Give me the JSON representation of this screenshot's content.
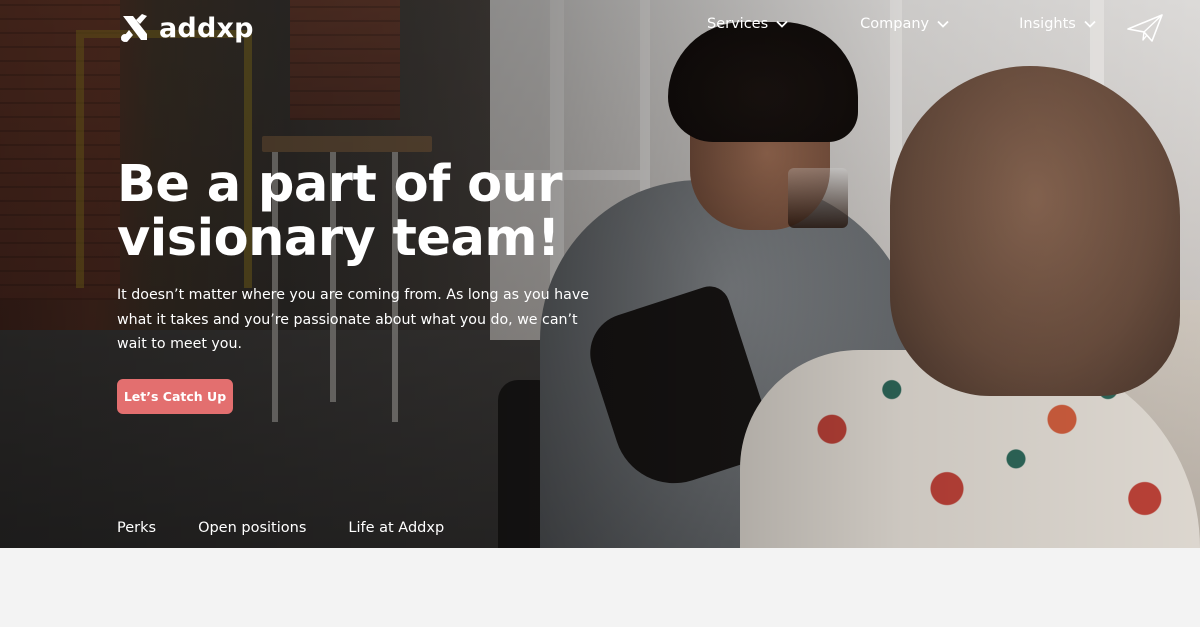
{
  "brand": {
    "name": "addxp"
  },
  "nav": {
    "items": [
      {
        "label": "Services"
      },
      {
        "label": "Company"
      },
      {
        "label": "Insights"
      }
    ],
    "contact_icon": "paper-plane-icon"
  },
  "hero": {
    "headline_line1": "Be a part of our",
    "headline_line2": "visionary team!",
    "description": "It doesn’t matter where you are coming from. As long as you have what it takes and you’re passionate about what you do, we can’t wait to meet you.",
    "cta_label": "Let’s Catch Up"
  },
  "subnav": {
    "items": [
      {
        "label": "Perks"
      },
      {
        "label": "Open positions"
      },
      {
        "label": "Life at Addxp"
      }
    ]
  },
  "colors": {
    "cta": "#e36f6f",
    "text": "#ffffff",
    "below_fold": "#f3f3f3"
  }
}
